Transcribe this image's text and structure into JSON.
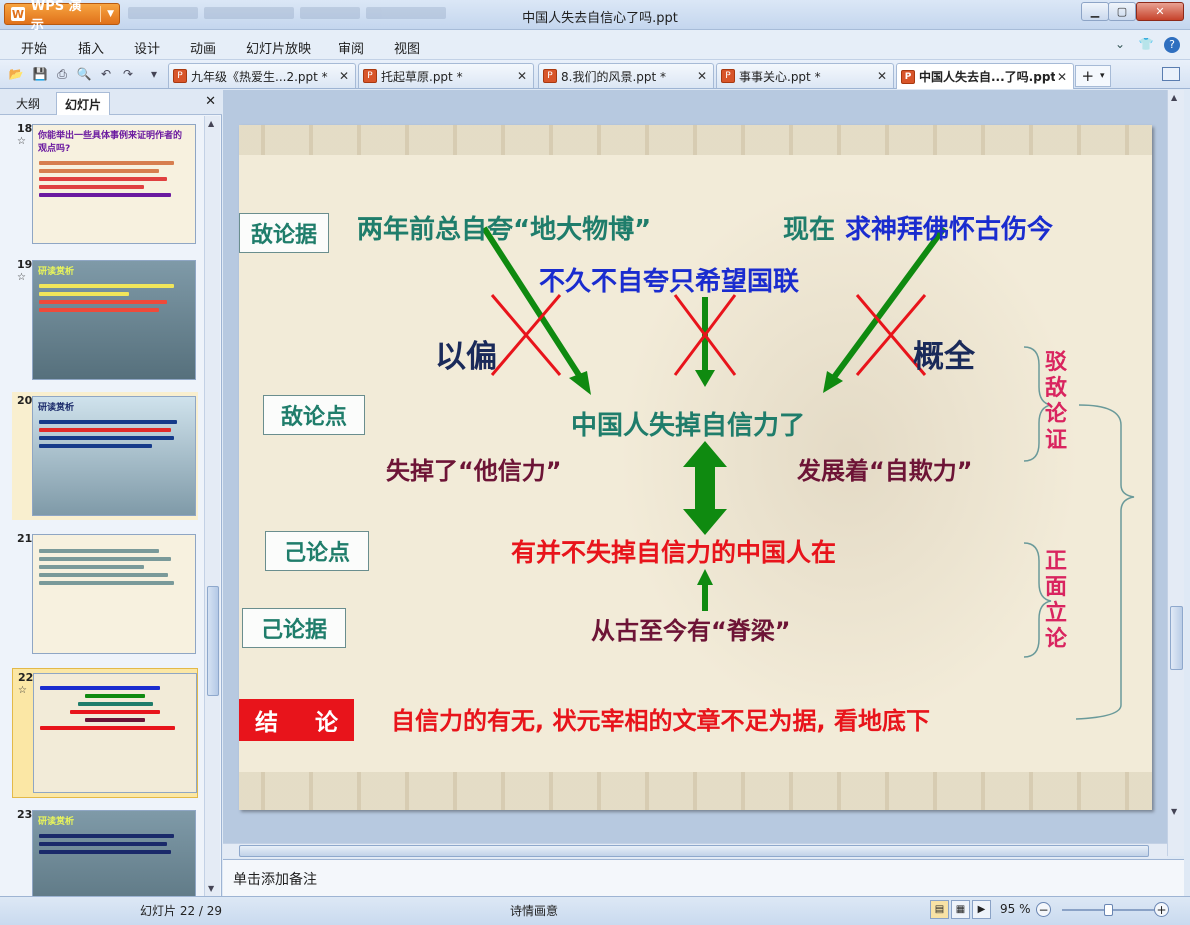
{
  "app": {
    "name": "WPS 演示",
    "logo": "W",
    "window_title": "中国人失去自信心了吗.ppt"
  },
  "menu": [
    "开始",
    "插入",
    "设计",
    "动画",
    "幻灯片放映",
    "审阅",
    "视图"
  ],
  "tabs": [
    {
      "label": "九年级《热爱生...2.ppt *",
      "active": false
    },
    {
      "label": "托起草原.ppt *",
      "active": false
    },
    {
      "label": "8.我们的风景.ppt *",
      "active": false
    },
    {
      "label": "事事关心.ppt *",
      "active": false
    },
    {
      "label": "中国人失去自...了吗.ppt",
      "active": true
    }
  ],
  "left_panel": {
    "tab_outline": "大纲",
    "tab_slides": "幻灯片",
    "thumbnails": [
      {
        "num": "18",
        "star": "☆",
        "title": "你能举出一些具体事例来证明作者的观点吗?",
        "selected": false
      },
      {
        "num": "19",
        "star": "☆",
        "title": "研读赏析",
        "selected": false
      },
      {
        "num": "20",
        "star": "",
        "title": "研读赏析",
        "selected": false
      },
      {
        "num": "21",
        "star": "",
        "title": "",
        "selected": false
      },
      {
        "num": "22",
        "star": "☆",
        "title": "",
        "selected": true
      },
      {
        "num": "23",
        "star": "",
        "title": "研读赏析",
        "selected": false
      }
    ]
  },
  "slide": {
    "label_enemy_evidence": "敌论据",
    "label_enemy_point": "敌论点",
    "label_own_point": "己论点",
    "label_own_evidence": "己论据",
    "evidence_1": "两年前总自夸“地大物博”",
    "evidence_2_prefix": "现在",
    "evidence_2": "求神拜佛怀古伤今",
    "evidence_3": "不久不自夸只希望国联",
    "partial_left": "以偏",
    "partial_right": "概全",
    "enemy_point_text": "中国人失掉自信力了",
    "lost_other": "失掉了“他信力”",
    "self_deceive": "发展着“自欺力”",
    "own_point_text": "有并不失掉自信力的中国人在",
    "own_evidence_text": "从古至今有“脊梁”",
    "refute_label": [
      "驳",
      "敌",
      "论",
      "证"
    ],
    "positive_label": [
      "正",
      "面",
      "立",
      "论"
    ],
    "conclusion_label_1": "结",
    "conclusion_label_2": "论",
    "conclusion_text": "自信力的有无, 状元宰相的文章不足为据, 看地底下"
  },
  "notes_placeholder": "单击添加备注",
  "status": {
    "page": "幻灯片 22 / 29",
    "theme": "诗情画意",
    "zoom": "95 %"
  },
  "colors": {
    "teal": "#1f7d6b",
    "blue": "#1a2ccf",
    "red": "#e8141b",
    "maroon": "#6d1436",
    "green": "#0f8a10",
    "pink": "#d9245f"
  }
}
